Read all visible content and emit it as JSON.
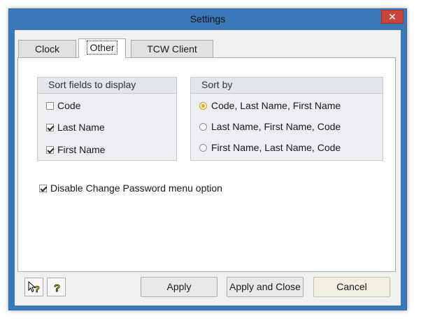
{
  "window": {
    "title": "Settings",
    "close_label": "✕"
  },
  "tabs": [
    {
      "label": "Clock",
      "selected": false
    },
    {
      "label": "Other",
      "selected": true
    },
    {
      "label": "TCW Client",
      "selected": false
    }
  ],
  "sort_fields_group": {
    "title": "Sort fields to display",
    "items": [
      {
        "label": "Code",
        "checked": false
      },
      {
        "label": "Last Name",
        "checked": true
      },
      {
        "label": "First Name",
        "checked": true
      }
    ]
  },
  "sort_by_group": {
    "title": "Sort by",
    "options": [
      {
        "label": "Code, Last Name, First Name",
        "selected": true
      },
      {
        "label": "Last Name, First Name, Code",
        "selected": false
      },
      {
        "label": "First Name, Last Name, Code",
        "selected": false
      }
    ]
  },
  "disable_password_option": {
    "label": "Disable Change Password menu option",
    "checked": true
  },
  "buttons": {
    "apply": "Apply",
    "apply_close": "Apply and Close",
    "cancel": "Cancel"
  },
  "icons": {
    "context_help": "pointer-help-icon",
    "help": "help-icon"
  },
  "colors": {
    "title_bar": "#3c78b8",
    "close_button": "#c9453a",
    "radio_selected": "#e0a81e"
  }
}
